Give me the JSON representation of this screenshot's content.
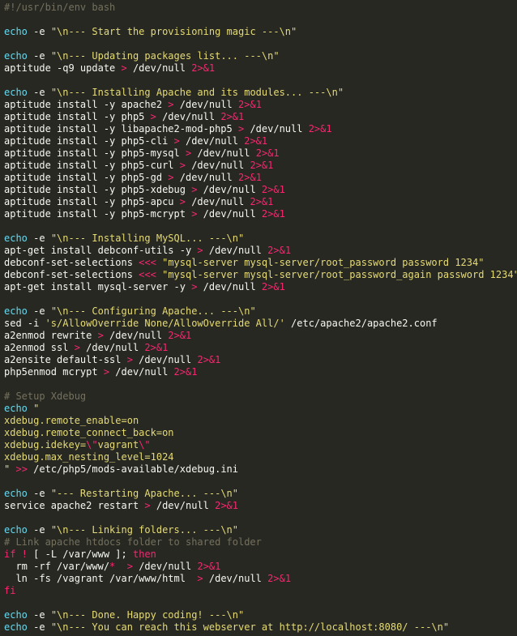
{
  "colors": {
    "background": "#272822",
    "plain": "#f8f8f2",
    "comment": "#75715e",
    "builtin": "#66d9ef",
    "string": "#e6db74",
    "operator": "#f92672"
  },
  "lines": [
    [
      [
        "cm",
        "#!/usr/bin/env bash"
      ]
    ],
    [],
    [
      [
        "bi",
        "echo"
      ],
      [
        "pl",
        " -e "
      ],
      [
        "st",
        "\"\\n--- Start the provisioning magic ---\\n\""
      ]
    ],
    [],
    [
      [
        "bi",
        "echo"
      ],
      [
        "pl",
        " -e "
      ],
      [
        "st",
        "\"\\n--- Updating packages list... ---\\n\""
      ]
    ],
    [
      [
        "pl",
        "aptitude -q9 update "
      ],
      [
        "op",
        ">"
      ],
      [
        "pl",
        " /dev/null "
      ],
      [
        "op",
        "2>&1"
      ]
    ],
    [],
    [
      [
        "bi",
        "echo"
      ],
      [
        "pl",
        " -e "
      ],
      [
        "st",
        "\"\\n--- Installing Apache and its modules... ---\\n\""
      ]
    ],
    [
      [
        "pl",
        "aptitude install -y apache2 "
      ],
      [
        "op",
        ">"
      ],
      [
        "pl",
        " /dev/null "
      ],
      [
        "op",
        "2>&1"
      ]
    ],
    [
      [
        "pl",
        "aptitude install -y php5 "
      ],
      [
        "op",
        ">"
      ],
      [
        "pl",
        " /dev/null "
      ],
      [
        "op",
        "2>&1"
      ]
    ],
    [
      [
        "pl",
        "aptitude install -y libapache2-mod-php5 "
      ],
      [
        "op",
        ">"
      ],
      [
        "pl",
        " /dev/null "
      ],
      [
        "op",
        "2>&1"
      ]
    ],
    [
      [
        "pl",
        "aptitude install -y php5-cli "
      ],
      [
        "op",
        ">"
      ],
      [
        "pl",
        " /dev/null "
      ],
      [
        "op",
        "2>&1"
      ]
    ],
    [
      [
        "pl",
        "aptitude install -y php5-mysql "
      ],
      [
        "op",
        ">"
      ],
      [
        "pl",
        " /dev/null "
      ],
      [
        "op",
        "2>&1"
      ]
    ],
    [
      [
        "pl",
        "aptitude install -y php5-curl "
      ],
      [
        "op",
        ">"
      ],
      [
        "pl",
        " /dev/null "
      ],
      [
        "op",
        "2>&1"
      ]
    ],
    [
      [
        "pl",
        "aptitude install -y php5-gd "
      ],
      [
        "op",
        ">"
      ],
      [
        "pl",
        " /dev/null "
      ],
      [
        "op",
        "2>&1"
      ]
    ],
    [
      [
        "pl",
        "aptitude install -y php5-xdebug "
      ],
      [
        "op",
        ">"
      ],
      [
        "pl",
        " /dev/null "
      ],
      [
        "op",
        "2>&1"
      ]
    ],
    [
      [
        "pl",
        "aptitude install -y php5-apcu "
      ],
      [
        "op",
        ">"
      ],
      [
        "pl",
        " /dev/null "
      ],
      [
        "op",
        "2>&1"
      ]
    ],
    [
      [
        "pl",
        "aptitude install -y php5-mcrypt "
      ],
      [
        "op",
        ">"
      ],
      [
        "pl",
        " /dev/null "
      ],
      [
        "op",
        "2>&1"
      ]
    ],
    [],
    [
      [
        "bi",
        "echo"
      ],
      [
        "pl",
        " -e "
      ],
      [
        "st",
        "\"\\n--- Installing MySQL... ---\\n\""
      ]
    ],
    [
      [
        "pl",
        "apt-get install debconf-utils -y "
      ],
      [
        "op",
        ">"
      ],
      [
        "pl",
        " /dev/null "
      ],
      [
        "op",
        "2>&1"
      ]
    ],
    [
      [
        "pl",
        "debconf-set-selections "
      ],
      [
        "op",
        "<<<"
      ],
      [
        "pl",
        " "
      ],
      [
        "st",
        "\"mysql-server mysql-server/root_password password 1234\""
      ]
    ],
    [
      [
        "pl",
        "debconf-set-selections "
      ],
      [
        "op",
        "<<<"
      ],
      [
        "pl",
        " "
      ],
      [
        "st",
        "\"mysql-server mysql-server/root_password_again password 1234\""
      ]
    ],
    [
      [
        "pl",
        "apt-get install mysql-server -y "
      ],
      [
        "op",
        ">"
      ],
      [
        "pl",
        " /dev/null "
      ],
      [
        "op",
        "2>&1"
      ]
    ],
    [],
    [
      [
        "bi",
        "echo"
      ],
      [
        "pl",
        " -e "
      ],
      [
        "st",
        "\"\\n--- Configuring Apache... ---\\n\""
      ]
    ],
    [
      [
        "pl",
        "sed -i "
      ],
      [
        "st",
        "'s/AllowOverride None/AllowOverride All/'"
      ],
      [
        "pl",
        " /etc/apache2/apache2.conf"
      ]
    ],
    [
      [
        "pl",
        "a2enmod rewrite "
      ],
      [
        "op",
        ">"
      ],
      [
        "pl",
        " /dev/null "
      ],
      [
        "op",
        "2>&1"
      ]
    ],
    [
      [
        "pl",
        "a2enmod ssl "
      ],
      [
        "op",
        ">"
      ],
      [
        "pl",
        " /dev/null "
      ],
      [
        "op",
        "2>&1"
      ]
    ],
    [
      [
        "pl",
        "a2ensite default-ssl "
      ],
      [
        "op",
        ">"
      ],
      [
        "pl",
        " /dev/null "
      ],
      [
        "op",
        "2>&1"
      ]
    ],
    [
      [
        "pl",
        "php5enmod mcrypt "
      ],
      [
        "op",
        ">"
      ],
      [
        "pl",
        " /dev/null "
      ],
      [
        "op",
        "2>&1"
      ]
    ],
    [],
    [
      [
        "cm",
        "# Setup Xdebug"
      ]
    ],
    [
      [
        "bi",
        "echo"
      ],
      [
        "pl",
        " "
      ],
      [
        "st",
        "\""
      ]
    ],
    [
      [
        "st",
        "xdebug.remote_enable=on"
      ]
    ],
    [
      [
        "st",
        "xdebug.remote_connect_back=on"
      ]
    ],
    [
      [
        "st",
        "xdebug.idekey="
      ],
      [
        "op",
        "\\\""
      ],
      [
        "st",
        "vagrant"
      ],
      [
        "op",
        "\\\""
      ]
    ],
    [
      [
        "st",
        "xdebug.max_nesting_level=1024"
      ]
    ],
    [
      [
        "st",
        "\""
      ],
      [
        "pl",
        " "
      ],
      [
        "op",
        ">>"
      ],
      [
        "pl",
        " /etc/php5/mods-available/xdebug.ini"
      ]
    ],
    [],
    [
      [
        "bi",
        "echo"
      ],
      [
        "pl",
        " -e "
      ],
      [
        "st",
        "\"--- Restarting Apache... ---\\n\""
      ]
    ],
    [
      [
        "pl",
        "service apache2 restart "
      ],
      [
        "op",
        ">"
      ],
      [
        "pl",
        " /dev/null "
      ],
      [
        "op",
        "2>&1"
      ]
    ],
    [],
    [
      [
        "bi",
        "echo"
      ],
      [
        "pl",
        " -e "
      ],
      [
        "st",
        "\"\\n--- Linking folders... ---\\n\""
      ]
    ],
    [
      [
        "cm",
        "# Link apache htdocs folder to shared folder"
      ]
    ],
    [
      [
        "kw",
        "if"
      ],
      [
        "pl",
        " "
      ],
      [
        "op",
        "!"
      ],
      [
        "pl",
        " [ -L /var/www ]; "
      ],
      [
        "kw",
        "then"
      ]
    ],
    [
      [
        "pl",
        "  rm -rf /var/www/"
      ],
      [
        "op",
        "*"
      ],
      [
        "pl",
        "  "
      ],
      [
        "op",
        ">"
      ],
      [
        "pl",
        " /dev/null "
      ],
      [
        "op",
        "2>&1"
      ]
    ],
    [
      [
        "pl",
        "  ln -fs /vagrant /var/www/html  "
      ],
      [
        "op",
        ">"
      ],
      [
        "pl",
        " /dev/null "
      ],
      [
        "op",
        "2>&1"
      ]
    ],
    [
      [
        "kw",
        "fi"
      ]
    ],
    [],
    [
      [
        "bi",
        "echo"
      ],
      [
        "pl",
        " -e "
      ],
      [
        "st",
        "\"\\n--- Done. Happy coding! ---\\n\""
      ]
    ],
    [
      [
        "bi",
        "echo"
      ],
      [
        "pl",
        " -e "
      ],
      [
        "st",
        "\"\\n--- You can reach this webserver at http://localhost:8080/ ---\\n\""
      ]
    ]
  ]
}
